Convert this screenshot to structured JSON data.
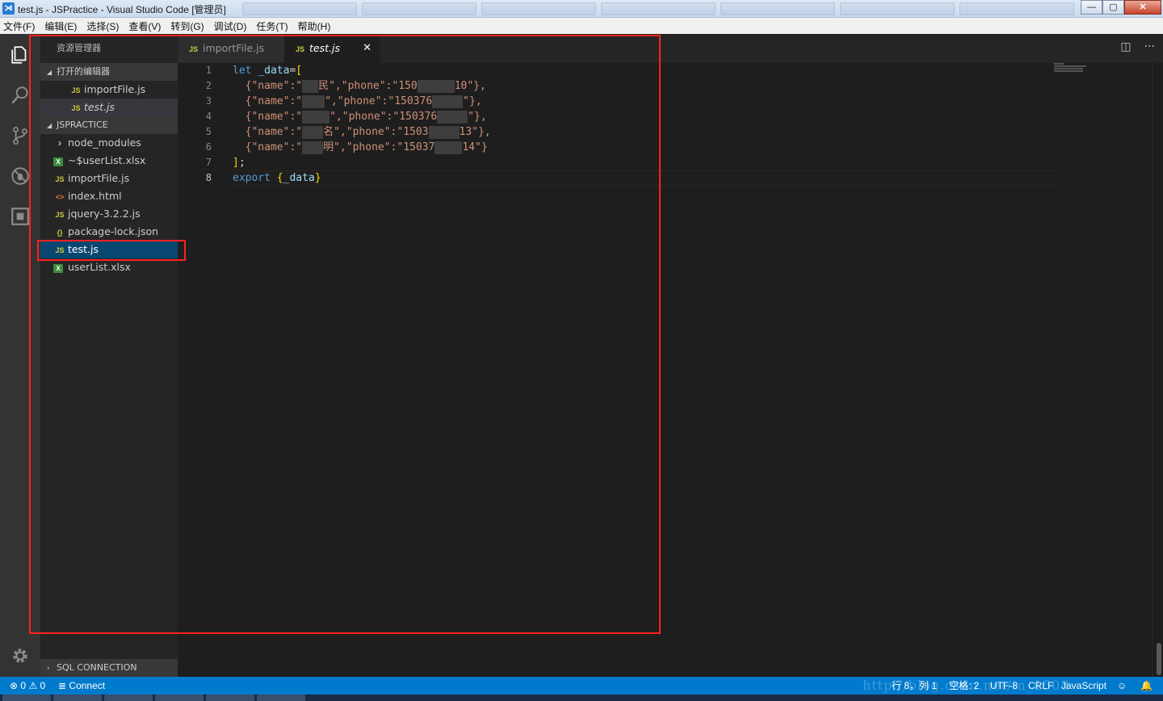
{
  "window": {
    "title": "test.js - JSPractice - Visual Studio Code [管理员]",
    "app_icon": "vscode-icon",
    "controls": {
      "minimize": "—",
      "maximize": "▢",
      "close": "✕"
    }
  },
  "menu": [
    "文件(F)",
    "编辑(E)",
    "选择(S)",
    "查看(V)",
    "转到(G)",
    "调试(D)",
    "任务(T)",
    "帮助(H)"
  ],
  "activity_bar": {
    "icons": [
      "files-icon",
      "search-icon",
      "source-control-icon",
      "debug-icon",
      "extensions-icon"
    ],
    "bottom_icon": "gear-icon"
  },
  "sidebar": {
    "title": "资源管理器",
    "open_editors": {
      "label": "打开的编辑器",
      "items": [
        {
          "icon": "JS",
          "label": "importFile.js"
        },
        {
          "icon": "JS",
          "label": "test.js"
        }
      ]
    },
    "project": {
      "label": "JSPRACTICE",
      "items": [
        {
          "icon": "›",
          "label": "node_modules",
          "type": "folder"
        },
        {
          "icon": "X",
          "label": "~$userList.xlsx",
          "type": "excel"
        },
        {
          "icon": "JS",
          "label": "importFile.js",
          "type": "js"
        },
        {
          "icon": "<>",
          "label": "index.html",
          "type": "html"
        },
        {
          "icon": "JS",
          "label": "jquery-3.2.2.js",
          "type": "js"
        },
        {
          "icon": "{}",
          "label": "package-lock.json",
          "type": "json"
        },
        {
          "icon": "JS",
          "label": "test.js",
          "type": "js",
          "selected": true
        },
        {
          "icon": "X",
          "label": "userList.xlsx",
          "type": "excel"
        }
      ]
    },
    "sql_section": "SQL CONNECTION"
  },
  "tabs": [
    {
      "icon": "JS",
      "label": "importFile.js",
      "active": false
    },
    {
      "icon": "JS",
      "label": "test.js",
      "active": true,
      "close": "✕"
    }
  ],
  "editor": {
    "line_numbers": [
      "1",
      "2",
      "3",
      "4",
      "5",
      "6",
      "7",
      "8"
    ],
    "current_line": "8",
    "lines": {
      "l1": {
        "kw": "let",
        "var": "_data",
        "eq": "=",
        "br": "["
      },
      "l2": {
        "a": "{\"name\":\"",
        "b": "民\",\"phone\":\"150",
        "c": "10\"},"
      },
      "l3": {
        "a": "{\"name\":\"",
        "b": "\",\"phone\":\"150376",
        "c": "\"},"
      },
      "l4": {
        "a": "{\"name\":\"",
        "b": "\",\"phone\":\"150376",
        "c": "\"},"
      },
      "l5": {
        "a": "{\"name\":\"",
        "b": "名\",\"phone\":\"1503",
        "c": "13\"},"
      },
      "l6": {
        "a": "{\"name\":\"",
        "b": "明\",\"phone\":\"15037",
        "c": "14\"}"
      },
      "l7": {
        "br": "]",
        "pu": ";"
      },
      "l8": {
        "kw": "export",
        "br1": "{",
        "var": "_data",
        "br2": "}"
      }
    }
  },
  "statusbar": {
    "errors": "0",
    "warnings": "0",
    "connect": "Connect",
    "position": "行 8，列 1",
    "spaces": "空格: 2",
    "encoding": "UTF-8",
    "eol": "CRLF",
    "language": "JavaScript",
    "watermark": "http://blog.csdn.net/in_1508",
    "feedback_icon": "smiley-icon",
    "bell_icon": "bell-icon"
  }
}
